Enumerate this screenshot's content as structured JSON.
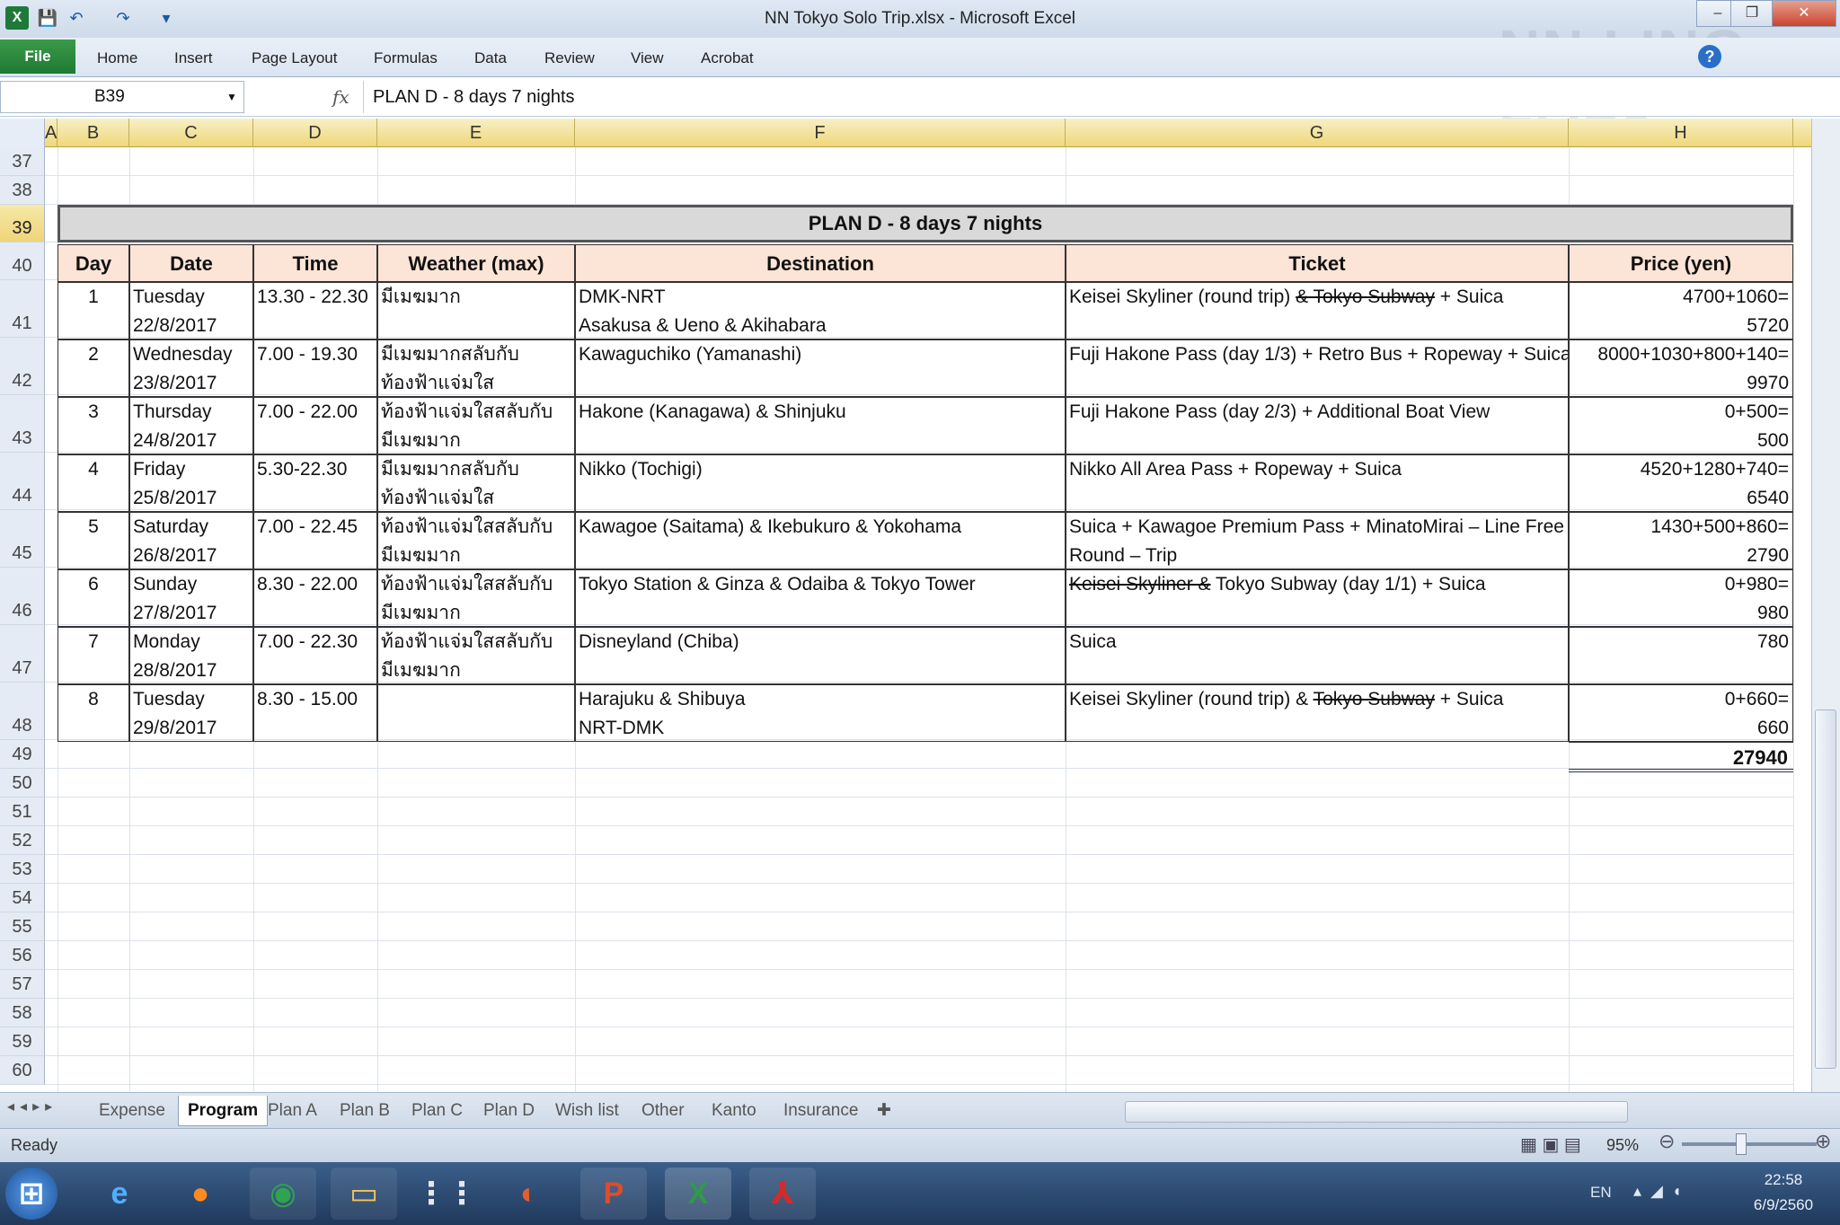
{
  "window": {
    "title": "NN Tokyo Solo Trip.xlsx - Microsoft Excel",
    "watermark": "NN LING-FOEK"
  },
  "ribbon": {
    "file": "File",
    "tabs": [
      "Home",
      "Insert",
      "Page Layout",
      "Formulas",
      "Data",
      "Review",
      "View",
      "Acrobat"
    ]
  },
  "formula_bar": {
    "name_box": "B39",
    "fx": "fx",
    "formula": "PLAN D  - 8 days 7 nights"
  },
  "columns": [
    "A",
    "B",
    "C",
    "D",
    "E",
    "F",
    "G",
    "H"
  ],
  "rows": [
    "37",
    "38",
    "39",
    "40",
    "41",
    "42",
    "43",
    "44",
    "45",
    "46",
    "47",
    "48",
    "49",
    "50",
    "51",
    "52",
    "53",
    "54",
    "55",
    "56",
    "57",
    "58",
    "59",
    "60"
  ],
  "selected_row": "39",
  "table": {
    "title": "PLAN D  - 8 days 7 nights",
    "headers": [
      "Day",
      "Date",
      "Time",
      "Weather (max)",
      "Destination",
      "Ticket",
      "Price (yen)"
    ],
    "rows": [
      {
        "day": "1",
        "date1": "Tuesday",
        "date2": "22/8/2017",
        "time": "13.30 - 22.30",
        "w1": "มีเมฆมาก",
        "w2": "",
        "d1": "DMK-NRT",
        "d2": "Asakusa & Ueno & Akihabara",
        "t1a": "Keisei Skyliner (round trip) ",
        "t1s": "& Tokyo Subway",
        "t1b": " + Suica",
        "t2": "",
        "p1": "4700+1060=",
        "p2": "5720"
      },
      {
        "day": "2",
        "date1": "Wednesday",
        "date2": "23/8/2017",
        "time": "7.00 - 19.30",
        "w1": "มีเมฆมากสลับกับ",
        "w2": "ท้องฟ้าแจ่มใส",
        "d1": "Kawaguchiko (Yamanashi)",
        "d2": "",
        "t1a": "Fuji Hakone Pass (day 1/3) + Retro Bus + Ropeway + Suica",
        "t1s": "",
        "t1b": "",
        "t2": "",
        "p1": "8000+1030+800+140=",
        "p2": "9970"
      },
      {
        "day": "3",
        "date1": "Thursday",
        "date2": "24/8/2017",
        "time": "7.00 - 22.00",
        "w1": "ท้องฟ้าแจ่มใสสลับกับ",
        "w2": "มีเมฆมาก",
        "d1": "Hakone (Kanagawa) & Shinjuku",
        "d2": "",
        "t1a": "Fuji Hakone Pass (day 2/3) + Additional Boat View",
        "t1s": "",
        "t1b": "",
        "t2": "",
        "p1": "0+500=",
        "p2": "500"
      },
      {
        "day": "4",
        "date1": "Friday",
        "date2": "25/8/2017",
        "time": "5.30-22.30",
        "w1": "มีเมฆมากสลับกับ",
        "w2": "ท้องฟ้าแจ่มใส",
        "d1": "Nikko (Tochigi)",
        "d2": "",
        "t1a": "Nikko All Area Pass + Ropeway + Suica",
        "t1s": "",
        "t1b": "",
        "t2": "",
        "p1": "4520+1280+740=",
        "p2": "6540"
      },
      {
        "day": "5",
        "date1": "Saturday",
        "date2": "26/8/2017",
        "time": "7.00 - 22.45",
        "w1": "ท้องฟ้าแจ่มใสสลับกับ",
        "w2": "มีเมฆมาก",
        "d1": "Kawagoe (Saitama) & Ikebukuro & Yokohama",
        "d2": "",
        "t1a": "Suica + Kawagoe Premium Pass + MinatoMirai – Line Free",
        "t1s": "",
        "t1b": "",
        "t2": "Round – Trip",
        "p1": "1430+500+860=",
        "p2": "2790"
      },
      {
        "day": "6",
        "date1": "Sunday",
        "date2": "27/8/2017",
        "time": "8.30 - 22.00",
        "w1": "ท้องฟ้าแจ่มใสสลับกับ",
        "w2": "มีเมฆมาก",
        "d1": "Tokyo Station & Ginza & Odaiba & Tokyo Tower",
        "d2": "",
        "t1a": "",
        "t1s": "Keisei Skyliner &",
        "t1b": " Tokyo Subway (day 1/1) + Suica",
        "t2": "",
        "p1": "0+980=",
        "p2": "980"
      },
      {
        "day": "7",
        "date1": "Monday",
        "date2": "28/8/2017",
        "time": "7.00 - 22.30",
        "w1": "ท้องฟ้าแจ่มใสสลับกับ",
        "w2": "มีเมฆมาก",
        "d1": "Disneyland (Chiba)",
        "d2": "",
        "t1a": "Suica",
        "t1s": "",
        "t1b": "",
        "t2": "",
        "p1": "780",
        "p2": ""
      },
      {
        "day": "8",
        "date1": "Tuesday",
        "date2": "29/8/2017",
        "time": "8.30 - 15.00",
        "w1": "",
        "w2": "",
        "d1": "Harajuku & Shibuya",
        "d2": "NRT-DMK",
        "t1a": "Keisei Skyliner (round trip) & ",
        "t1s": "Tokyo Subway",
        "t1b": " + Suica",
        "t2": "",
        "p1": "0+660=",
        "p2": "660"
      }
    ],
    "total": "27940"
  },
  "sheets": [
    "Expense",
    "Program",
    "Plan A",
    "Plan B",
    "Plan C",
    "Plan D",
    "Wish list",
    "Other",
    "Kanto",
    "Insurance"
  ],
  "active_sheet": "Program",
  "status": {
    "text": "Ready",
    "zoom": "95%"
  },
  "taskbar": {
    "lang": "EN",
    "time": "22:58",
    "date": "6/9/2560"
  }
}
